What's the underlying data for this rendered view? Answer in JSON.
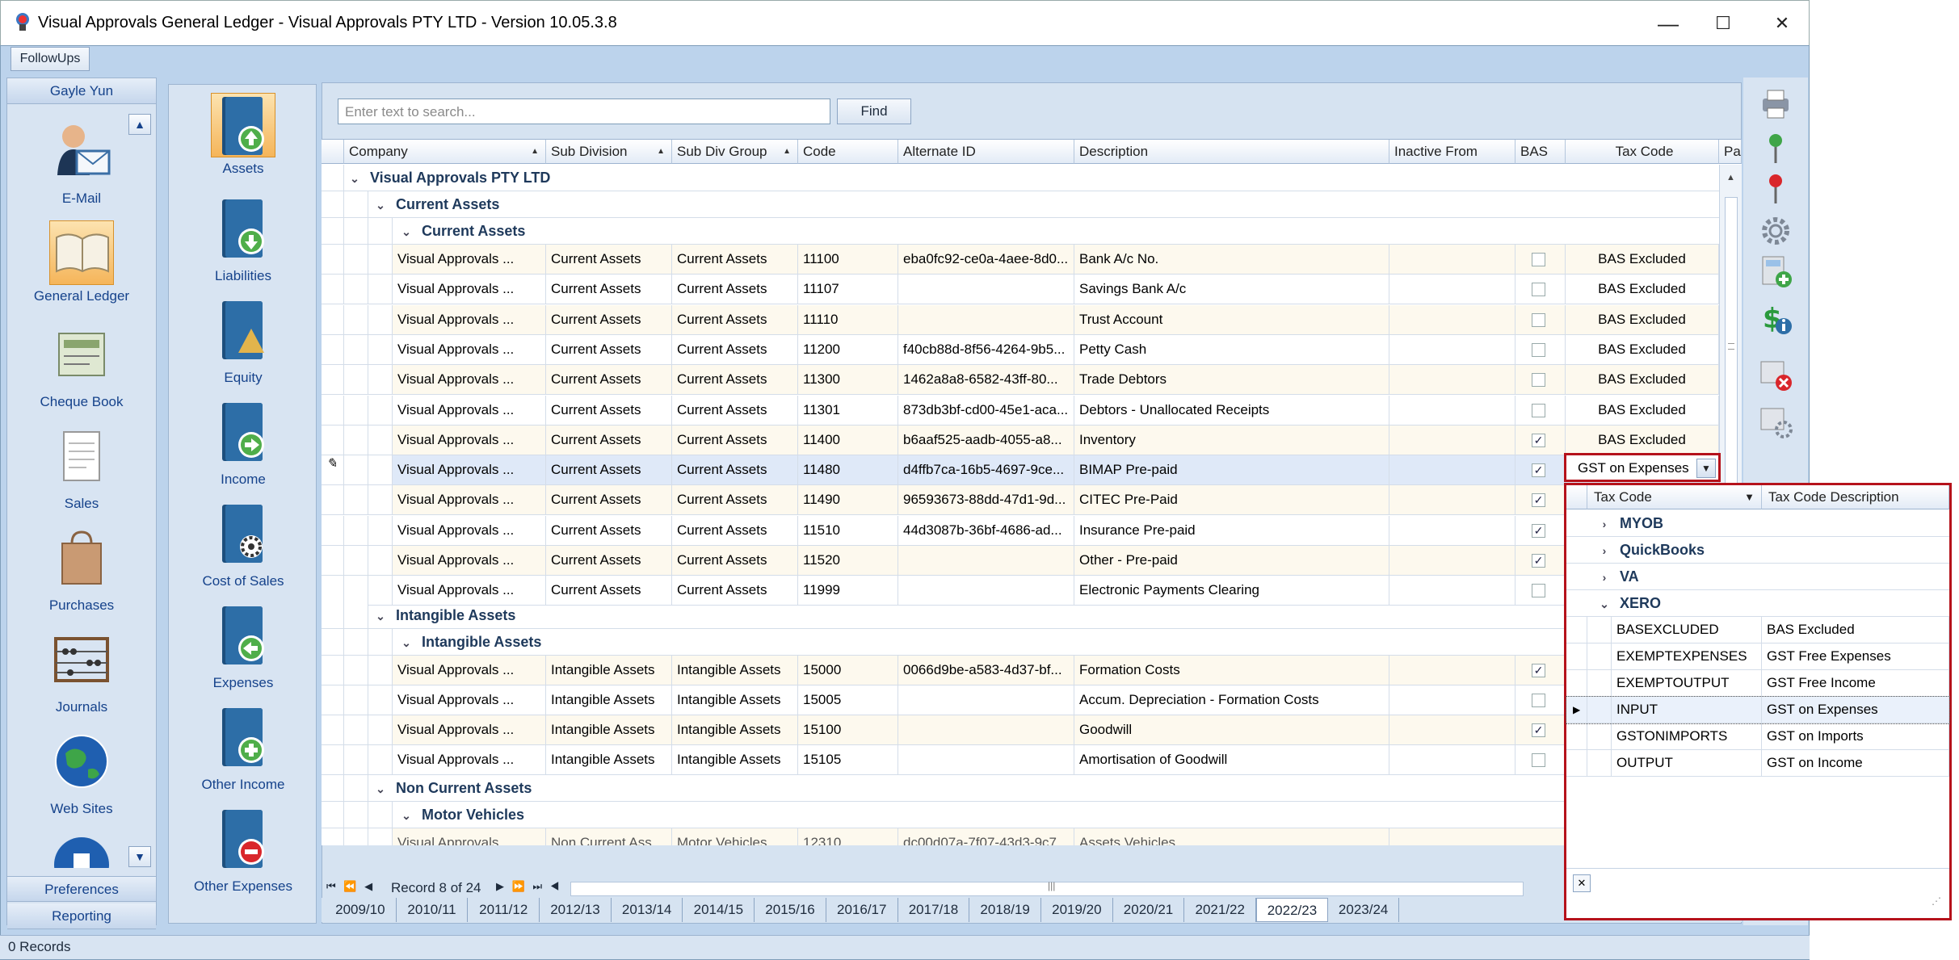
{
  "window": {
    "title": "Visual Approvals General Ledger - Visual Approvals PTY LTD - Version 10.05.3.8",
    "minimize": "—",
    "maximize": "☐",
    "close": "✕"
  },
  "toolbar": {
    "followups": "FollowUps"
  },
  "left_nav": {
    "user": "Gayle Yun",
    "items": [
      "E-Mail",
      "General Ledger",
      "Cheque Book",
      "Sales",
      "Purchases",
      "Journals",
      "Web Sites"
    ],
    "bottom": [
      "Preferences",
      "Reporting"
    ]
  },
  "categories": [
    "Assets",
    "Liabilities",
    "Equity",
    "Income",
    "Cost of Sales",
    "Expenses",
    "Other Income",
    "Other Expenses"
  ],
  "search": {
    "placeholder": "Enter text to search...",
    "find": "Find"
  },
  "grid": {
    "headers": [
      "Company",
      "Sub Division",
      "Sub Div Group",
      "Code",
      "Alternate ID",
      "Description",
      "Inactive From",
      "BAS",
      "Tax Code",
      "Pa"
    ],
    "groups": {
      "company": "Visual Approvals PTY LTD",
      "current_assets_sub": "Current Assets",
      "current_assets_grp": "Current Assets",
      "intangible_sub": "Intangible Assets",
      "intangible_grp": "Intangible Assets",
      "noncurrent_sub": "Non Current Assets",
      "motor_grp": "Motor Vehicles"
    },
    "rows_current": [
      {
        "company": "Visual Approvals ...",
        "sub": "Current Assets",
        "grp": "Current Assets",
        "code": "11100",
        "alt": "eba0fc92-ce0a-4aee-8d0...",
        "desc": "Bank A/c No.",
        "bas": false,
        "tax": "BAS Excluded"
      },
      {
        "company": "Visual Approvals ...",
        "sub": "Current Assets",
        "grp": "Current Assets",
        "code": "11107",
        "alt": "",
        "desc": "Savings Bank A/c",
        "bas": false,
        "tax": "BAS Excluded"
      },
      {
        "company": "Visual Approvals ...",
        "sub": "Current Assets",
        "grp": "Current Assets",
        "code": "11110",
        "alt": "",
        "desc": "Trust Account",
        "bas": false,
        "tax": "BAS Excluded"
      },
      {
        "company": "Visual Approvals ...",
        "sub": "Current Assets",
        "grp": "Current Assets",
        "code": "11200",
        "alt": "f40cb88d-8f56-4264-9b5...",
        "desc": "Petty Cash",
        "bas": false,
        "tax": "BAS Excluded"
      },
      {
        "company": "Visual Approvals ...",
        "sub": "Current Assets",
        "grp": "Current Assets",
        "code": "11300",
        "alt": "1462a8a8-6582-43ff-80...",
        "desc": "Trade Debtors",
        "bas": false,
        "tax": "BAS Excluded"
      },
      {
        "company": "Visual Approvals ...",
        "sub": "Current Assets",
        "grp": "Current Assets",
        "code": "11301",
        "alt": "873db3bf-cd00-45e1-aca...",
        "desc": "Debtors - Unallocated Receipts",
        "bas": false,
        "tax": "BAS Excluded"
      },
      {
        "company": "Visual Approvals ...",
        "sub": "Current Assets",
        "grp": "Current Assets",
        "code": "11400",
        "alt": "b6aaf525-aadb-4055-a8...",
        "desc": "Inventory",
        "bas": true,
        "tax": "BAS Excluded"
      },
      {
        "company": "Visual Approvals ...",
        "sub": "Current Assets",
        "grp": "Current Assets",
        "code": "11480",
        "alt": "d4ffb7ca-16b5-4697-9ce...",
        "desc": "BIMAP Pre-paid",
        "bas": true,
        "tax": ""
      },
      {
        "company": "Visual Approvals ...",
        "sub": "Current Assets",
        "grp": "Current Assets",
        "code": "11490",
        "alt": "96593673-88dd-47d1-9d...",
        "desc": "CITEC Pre-Paid",
        "bas": true,
        "tax": ""
      },
      {
        "company": "Visual Approvals ...",
        "sub": "Current Assets",
        "grp": "Current Assets",
        "code": "11510",
        "alt": "44d3087b-36bf-4686-ad...",
        "desc": "Insurance Pre-paid",
        "bas": true,
        "tax": ""
      },
      {
        "company": "Visual Approvals ...",
        "sub": "Current Assets",
        "grp": "Current Assets",
        "code": "11520",
        "alt": "",
        "desc": "Other - Pre-paid",
        "bas": true,
        "tax": ""
      },
      {
        "company": "Visual Approvals ...",
        "sub": "Current Assets",
        "grp": "Current Assets",
        "code": "11999",
        "alt": "",
        "desc": "Electronic Payments Clearing",
        "bas": false,
        "tax": ""
      }
    ],
    "rows_intangible": [
      {
        "company": "Visual Approvals ...",
        "sub": "Intangible Assets",
        "grp": "Intangible Assets",
        "code": "15000",
        "alt": "0066d9be-a583-4d37-bf...",
        "desc": "Formation Costs",
        "bas": true,
        "tax": ""
      },
      {
        "company": "Visual Approvals ...",
        "sub": "Intangible Assets",
        "grp": "Intangible Assets",
        "code": "15005",
        "alt": "",
        "desc": "Accum. Depreciation - Formation Costs",
        "bas": false,
        "tax": ""
      },
      {
        "company": "Visual Approvals ...",
        "sub": "Intangible Assets",
        "grp": "Intangible Assets",
        "code": "15100",
        "alt": "",
        "desc": "Goodwill",
        "bas": true,
        "tax": ""
      },
      {
        "company": "Visual Approvals ...",
        "sub": "Intangible Assets",
        "grp": "Intangible Assets",
        "code": "15105",
        "alt": "",
        "desc": "Amortisation of  Goodwill",
        "bas": false,
        "tax": ""
      }
    ],
    "partial_row": {
      "company": "Visual Approvals",
      "sub": "Non Current Ass",
      "grp": "Motor Vehicles",
      "code": "12310",
      "alt": "dc00d07a-7f07-43d3-9c7",
      "desc": "Assets Vehicles"
    },
    "record_nav": "Record 8 of 24"
  },
  "year_tabs": [
    "2009/10",
    "2010/11",
    "2011/12",
    "2012/13",
    "2013/14",
    "2014/15",
    "2015/16",
    "2016/17",
    "2017/18",
    "2018/19",
    "2019/20",
    "2020/21",
    "2021/22",
    "2022/23",
    "2023/24"
  ],
  "active_year": "2022/23",
  "status": "0 Records",
  "tax_combo": {
    "value": "GST on Expenses",
    "popup_headers": [
      "Tax Code",
      "Tax Code Description"
    ],
    "groups": [
      "MYOB",
      "QuickBooks",
      "VA",
      "XERO"
    ],
    "rows": [
      {
        "code": "BASEXCLUDED",
        "desc": "BAS Excluded"
      },
      {
        "code": "EXEMPTEXPENSES",
        "desc": "GST Free Expenses"
      },
      {
        "code": "EXEMPTOUTPUT",
        "desc": "GST Free Income"
      },
      {
        "code": "INPUT",
        "desc": "GST on Expenses"
      },
      {
        "code": "GSTONIMPORTS",
        "desc": "GST on Imports"
      },
      {
        "code": "OUTPUT",
        "desc": "GST on Income"
      }
    ],
    "selected": "INPUT"
  },
  "colors": {
    "accent": "#15428b",
    "highlight_border": "#b5121b",
    "grid_band": "#fdf9ee"
  }
}
